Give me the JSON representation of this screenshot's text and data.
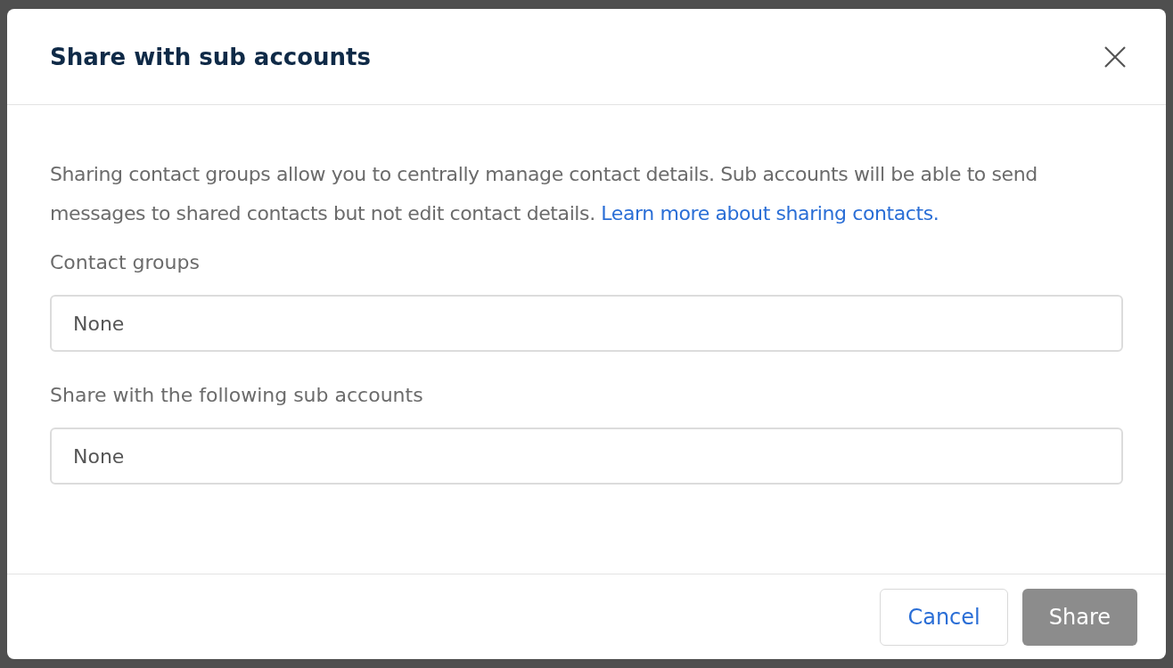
{
  "dialog": {
    "title": "Share with sub accounts",
    "description": "Sharing contact groups allow you to centrally manage contact details. Sub accounts will be able to send messages to shared contacts but not edit contact details.",
    "link": "Learn more about sharing contacts.",
    "fields": [
      {
        "label": "Contact groups",
        "value": "None"
      },
      {
        "label": "Share with the following sub accounts",
        "value": "None"
      }
    ],
    "buttons": [
      {
        "label": "Cancel",
        "kind": "secondary",
        "disabled": false
      },
      {
        "label": "Share",
        "kind": "primary",
        "disabled": true
      }
    ]
  }
}
